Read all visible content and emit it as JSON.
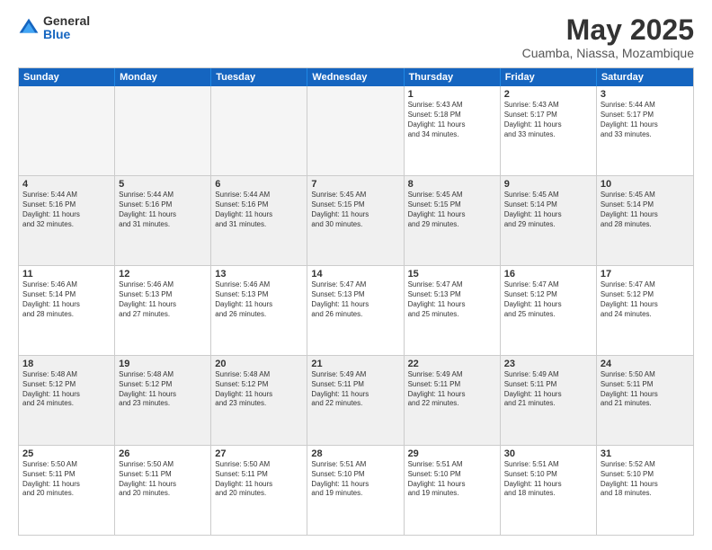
{
  "logo": {
    "general": "General",
    "blue": "Blue"
  },
  "title": "May 2025",
  "subtitle": "Cuamba, Niassa, Mozambique",
  "days": [
    "Sunday",
    "Monday",
    "Tuesday",
    "Wednesday",
    "Thursday",
    "Friday",
    "Saturday"
  ],
  "weeks": [
    [
      {
        "num": "",
        "text": "",
        "empty": true
      },
      {
        "num": "",
        "text": "",
        "empty": true
      },
      {
        "num": "",
        "text": "",
        "empty": true
      },
      {
        "num": "",
        "text": "",
        "empty": true
      },
      {
        "num": "1",
        "text": "Sunrise: 5:43 AM\nSunset: 5:18 PM\nDaylight: 11 hours\nand 34 minutes.",
        "empty": false
      },
      {
        "num": "2",
        "text": "Sunrise: 5:43 AM\nSunset: 5:17 PM\nDaylight: 11 hours\nand 33 minutes.",
        "empty": false
      },
      {
        "num": "3",
        "text": "Sunrise: 5:44 AM\nSunset: 5:17 PM\nDaylight: 11 hours\nand 33 minutes.",
        "empty": false
      }
    ],
    [
      {
        "num": "4",
        "text": "Sunrise: 5:44 AM\nSunset: 5:16 PM\nDaylight: 11 hours\nand 32 minutes.",
        "empty": false
      },
      {
        "num": "5",
        "text": "Sunrise: 5:44 AM\nSunset: 5:16 PM\nDaylight: 11 hours\nand 31 minutes.",
        "empty": false
      },
      {
        "num": "6",
        "text": "Sunrise: 5:44 AM\nSunset: 5:16 PM\nDaylight: 11 hours\nand 31 minutes.",
        "empty": false
      },
      {
        "num": "7",
        "text": "Sunrise: 5:45 AM\nSunset: 5:15 PM\nDaylight: 11 hours\nand 30 minutes.",
        "empty": false
      },
      {
        "num": "8",
        "text": "Sunrise: 5:45 AM\nSunset: 5:15 PM\nDaylight: 11 hours\nand 29 minutes.",
        "empty": false
      },
      {
        "num": "9",
        "text": "Sunrise: 5:45 AM\nSunset: 5:14 PM\nDaylight: 11 hours\nand 29 minutes.",
        "empty": false
      },
      {
        "num": "10",
        "text": "Sunrise: 5:45 AM\nSunset: 5:14 PM\nDaylight: 11 hours\nand 28 minutes.",
        "empty": false
      }
    ],
    [
      {
        "num": "11",
        "text": "Sunrise: 5:46 AM\nSunset: 5:14 PM\nDaylight: 11 hours\nand 28 minutes.",
        "empty": false
      },
      {
        "num": "12",
        "text": "Sunrise: 5:46 AM\nSunset: 5:13 PM\nDaylight: 11 hours\nand 27 minutes.",
        "empty": false
      },
      {
        "num": "13",
        "text": "Sunrise: 5:46 AM\nSunset: 5:13 PM\nDaylight: 11 hours\nand 26 minutes.",
        "empty": false
      },
      {
        "num": "14",
        "text": "Sunrise: 5:47 AM\nSunset: 5:13 PM\nDaylight: 11 hours\nand 26 minutes.",
        "empty": false
      },
      {
        "num": "15",
        "text": "Sunrise: 5:47 AM\nSunset: 5:13 PM\nDaylight: 11 hours\nand 25 minutes.",
        "empty": false
      },
      {
        "num": "16",
        "text": "Sunrise: 5:47 AM\nSunset: 5:12 PM\nDaylight: 11 hours\nand 25 minutes.",
        "empty": false
      },
      {
        "num": "17",
        "text": "Sunrise: 5:47 AM\nSunset: 5:12 PM\nDaylight: 11 hours\nand 24 minutes.",
        "empty": false
      }
    ],
    [
      {
        "num": "18",
        "text": "Sunrise: 5:48 AM\nSunset: 5:12 PM\nDaylight: 11 hours\nand 24 minutes.",
        "empty": false
      },
      {
        "num": "19",
        "text": "Sunrise: 5:48 AM\nSunset: 5:12 PM\nDaylight: 11 hours\nand 23 minutes.",
        "empty": false
      },
      {
        "num": "20",
        "text": "Sunrise: 5:48 AM\nSunset: 5:12 PM\nDaylight: 11 hours\nand 23 minutes.",
        "empty": false
      },
      {
        "num": "21",
        "text": "Sunrise: 5:49 AM\nSunset: 5:11 PM\nDaylight: 11 hours\nand 22 minutes.",
        "empty": false
      },
      {
        "num": "22",
        "text": "Sunrise: 5:49 AM\nSunset: 5:11 PM\nDaylight: 11 hours\nand 22 minutes.",
        "empty": false
      },
      {
        "num": "23",
        "text": "Sunrise: 5:49 AM\nSunset: 5:11 PM\nDaylight: 11 hours\nand 21 minutes.",
        "empty": false
      },
      {
        "num": "24",
        "text": "Sunrise: 5:50 AM\nSunset: 5:11 PM\nDaylight: 11 hours\nand 21 minutes.",
        "empty": false
      }
    ],
    [
      {
        "num": "25",
        "text": "Sunrise: 5:50 AM\nSunset: 5:11 PM\nDaylight: 11 hours\nand 20 minutes.",
        "empty": false
      },
      {
        "num": "26",
        "text": "Sunrise: 5:50 AM\nSunset: 5:11 PM\nDaylight: 11 hours\nand 20 minutes.",
        "empty": false
      },
      {
        "num": "27",
        "text": "Sunrise: 5:50 AM\nSunset: 5:11 PM\nDaylight: 11 hours\nand 20 minutes.",
        "empty": false
      },
      {
        "num": "28",
        "text": "Sunrise: 5:51 AM\nSunset: 5:10 PM\nDaylight: 11 hours\nand 19 minutes.",
        "empty": false
      },
      {
        "num": "29",
        "text": "Sunrise: 5:51 AM\nSunset: 5:10 PM\nDaylight: 11 hours\nand 19 minutes.",
        "empty": false
      },
      {
        "num": "30",
        "text": "Sunrise: 5:51 AM\nSunset: 5:10 PM\nDaylight: 11 hours\nand 18 minutes.",
        "empty": false
      },
      {
        "num": "31",
        "text": "Sunrise: 5:52 AM\nSunset: 5:10 PM\nDaylight: 11 hours\nand 18 minutes.",
        "empty": false
      }
    ]
  ]
}
